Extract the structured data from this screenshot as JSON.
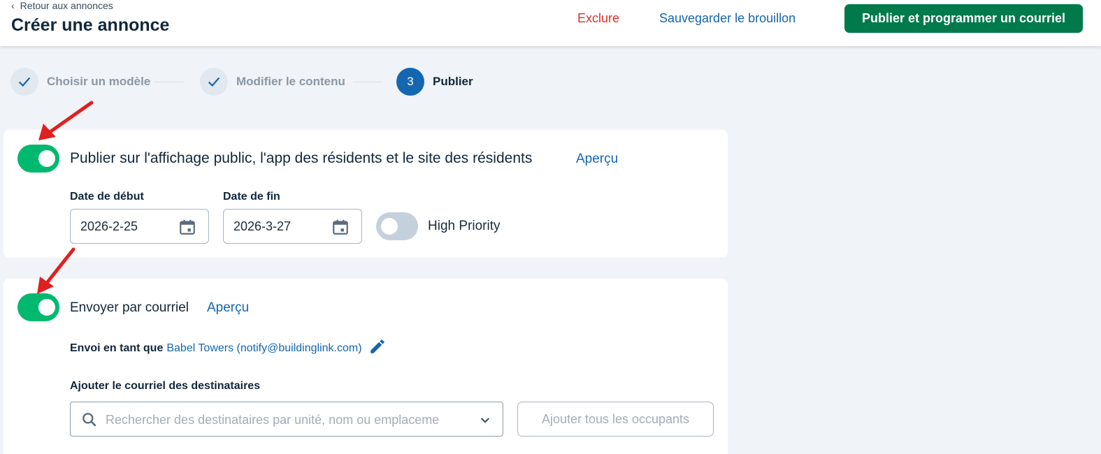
{
  "header": {
    "back_label": "Retour aux annonces",
    "title": "Créer une annonce",
    "exclude_label": "Exclure",
    "save_draft_label": "Sauvegarder le brouillon",
    "publish_label": "Publier et programmer un courriel"
  },
  "stepper": {
    "steps": [
      {
        "label": "Choisir un modèle",
        "state": "done"
      },
      {
        "label": "Modifier le contenu",
        "state": "done"
      },
      {
        "number": "3",
        "label": "Publier",
        "state": "active"
      }
    ]
  },
  "public_display": {
    "enabled": true,
    "label": "Publier sur l'affichage public, l'app des résidents et le site des résidents",
    "preview_label": "Aperçu",
    "start_date_label": "Date de début",
    "start_date_value": "2026-2-25",
    "end_date_label": "Date de fin",
    "end_date_value": "2026-3-27",
    "high_priority_enabled": false,
    "high_priority_label": "High Priority"
  },
  "email": {
    "enabled": true,
    "label": "Envoyer par courriel",
    "preview_label": "Aperçu",
    "sender_prefix": "Envoi en tant que",
    "sender_value": "Babel Towers (notify@buildinglink.com)",
    "recipients_label": "Ajouter le courriel des destinataires",
    "search_placeholder": "Rechercher des destinataires par unité, nom ou emplaceme",
    "add_all_label": "Ajouter tous les occupants"
  },
  "colors": {
    "toggle_on": "#00b96f",
    "primary_button": "#007a4b",
    "link": "#1566b0",
    "danger": "#d93025",
    "annotation_arrow": "#e02020"
  }
}
